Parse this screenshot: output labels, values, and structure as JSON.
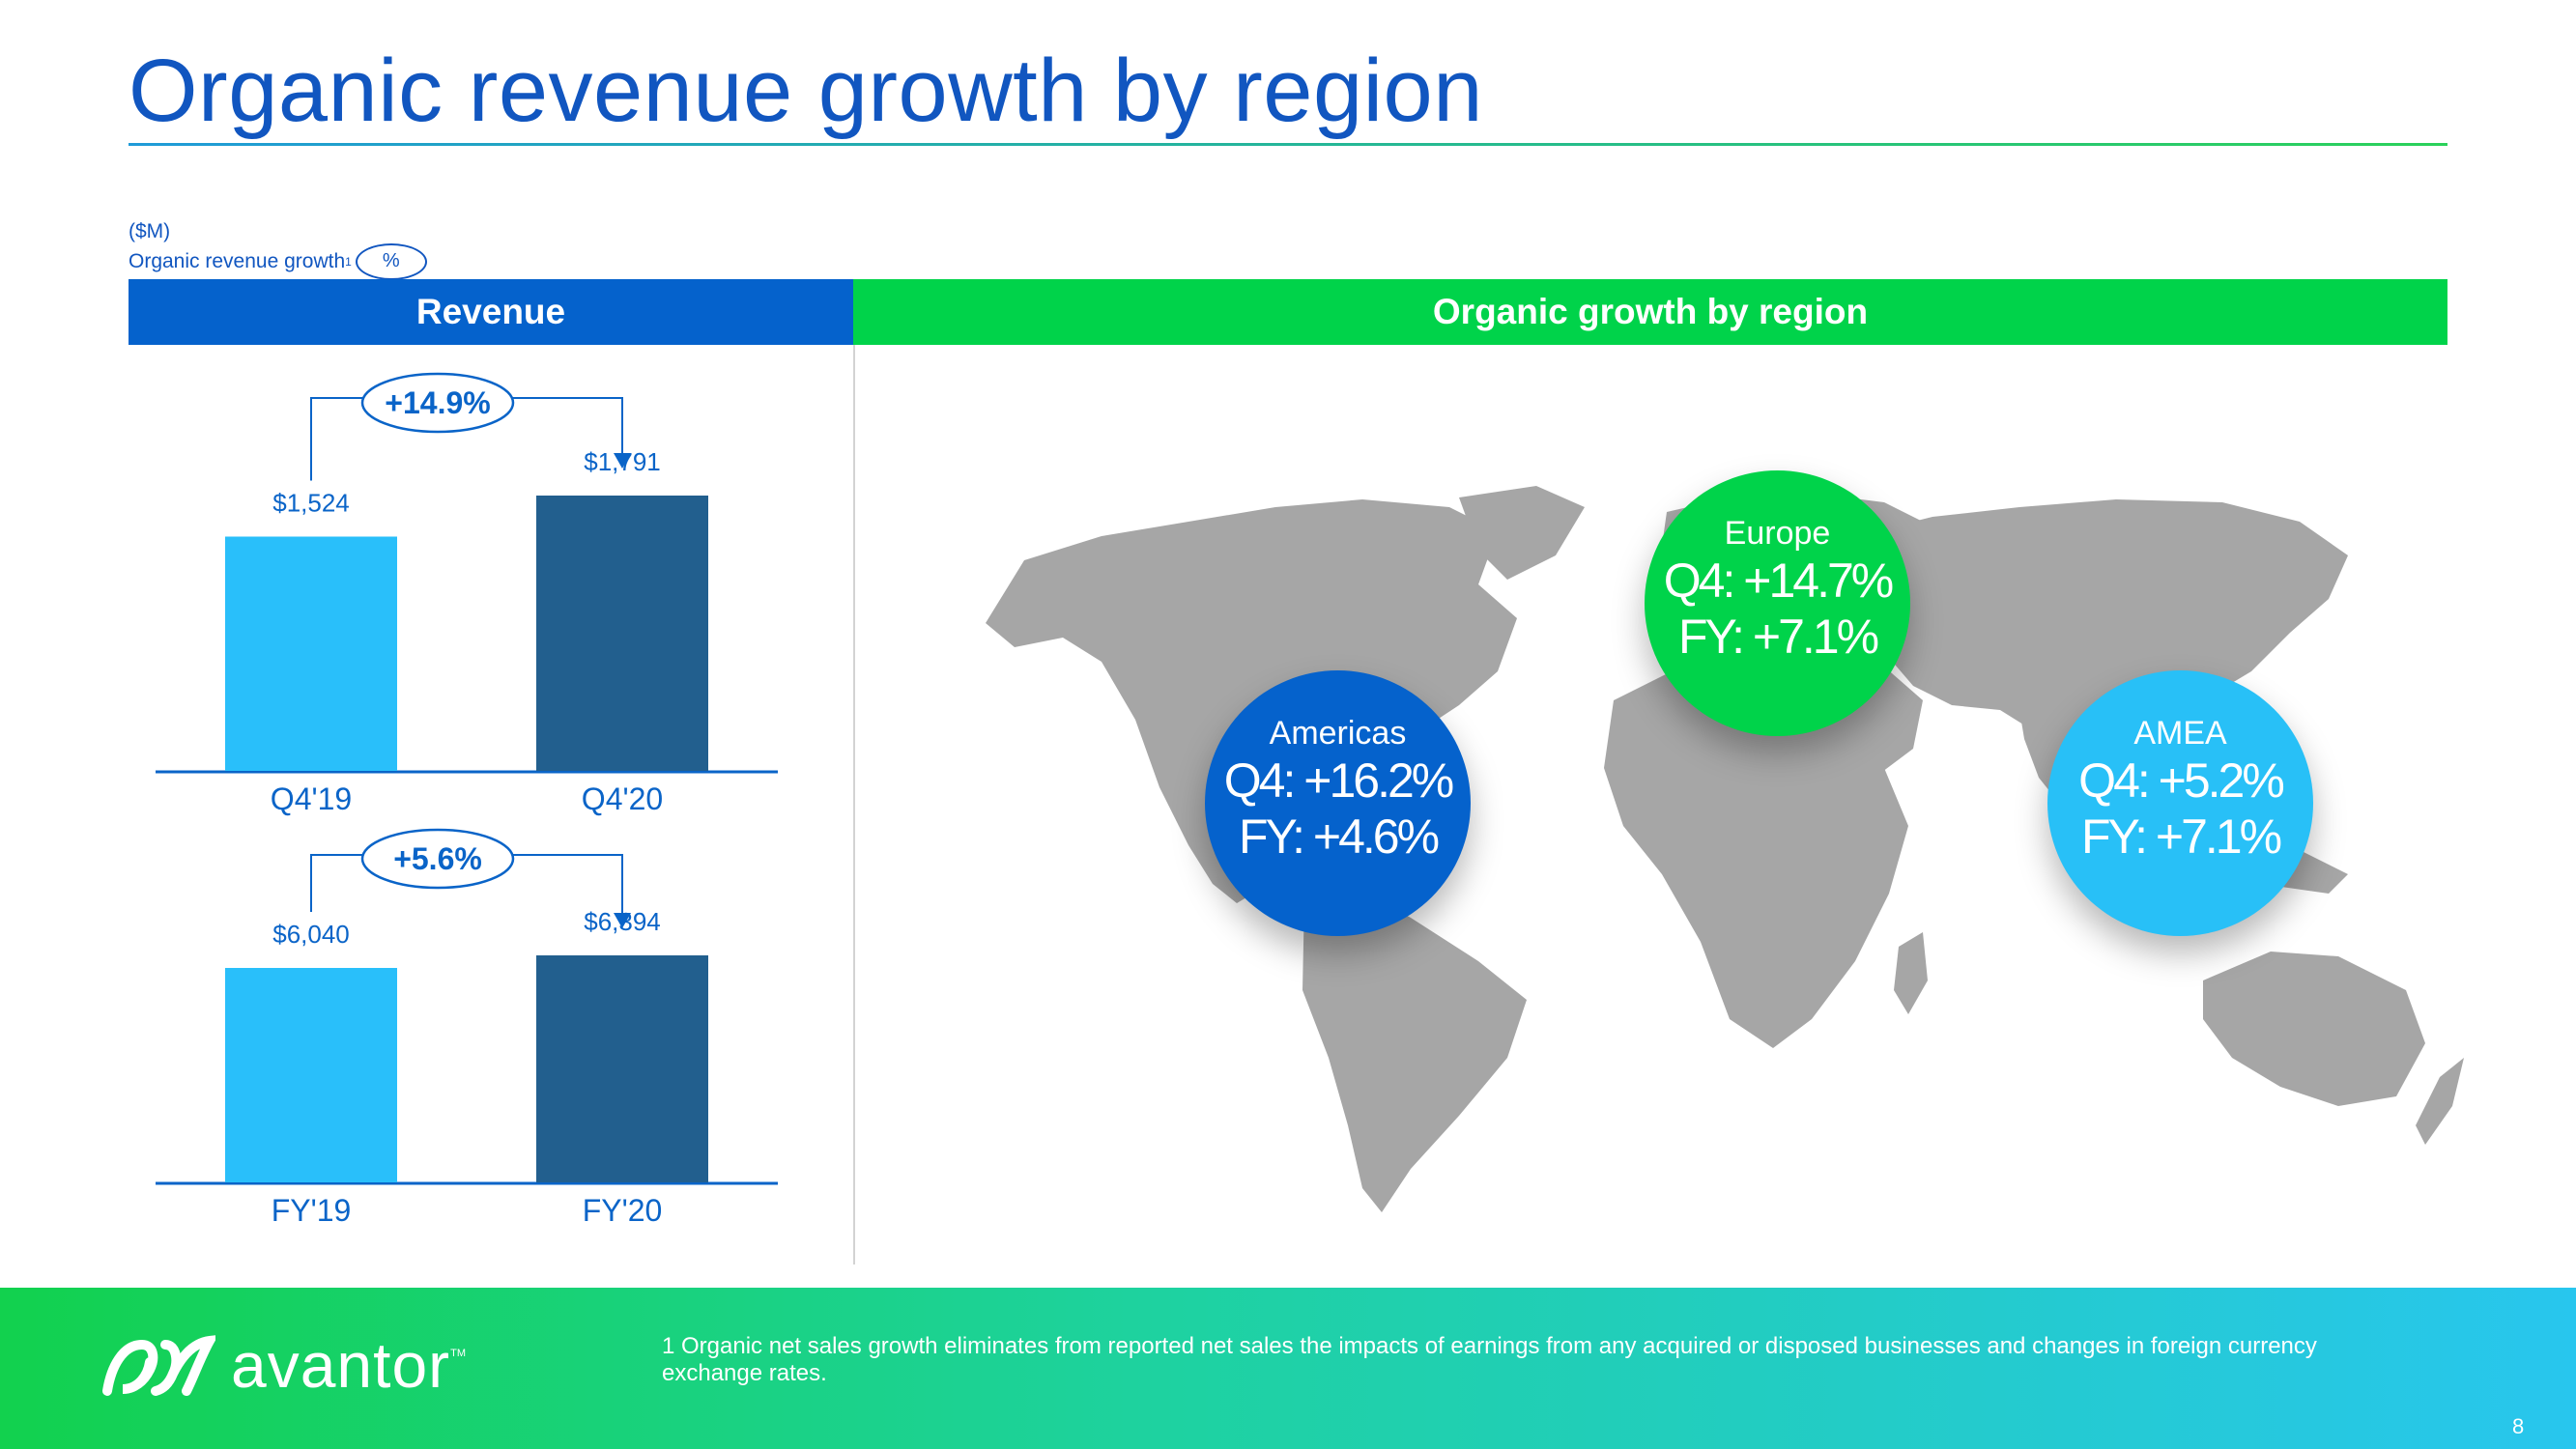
{
  "title": "Organic revenue growth by region",
  "legend": {
    "units": "($M)",
    "growth_label": "Organic revenue growth",
    "growth_sup": "1",
    "pct_symbol": "%"
  },
  "headers": {
    "revenue": "Revenue",
    "region": "Organic growth by region"
  },
  "chart_data": [
    {
      "type": "bar",
      "categories": [
        "Q4'19",
        "Q4'20"
      ],
      "values": [
        1524,
        1791
      ],
      "labels": [
        "$1,524",
        "$1,791"
      ],
      "growth": "+14.9%",
      "colors": [
        "#29bffa",
        "#225f8e"
      ]
    },
    {
      "type": "bar",
      "categories": [
        "FY'19",
        "FY'20"
      ],
      "values": [
        6040,
        6394
      ],
      "labels": [
        "$6,040",
        "$6,394"
      ],
      "growth": "+5.6%",
      "colors": [
        "#29bffa",
        "#225f8e"
      ]
    }
  ],
  "regions": {
    "americas": {
      "name": "Americas",
      "q4": "Q4: +16.2%",
      "fy": "FY: +4.6%",
      "color": "#0562cc"
    },
    "europe": {
      "name": "Europe",
      "q4": "Q4: +14.7%",
      "fy": "FY: +7.1%",
      "color": "#00d34a"
    },
    "amea": {
      "name": "AMEA",
      "q4": "Q4: +5.2%",
      "fy": "FY: +7.1%",
      "color": "#28c0f7"
    }
  },
  "footer": {
    "logo_text": "avantor",
    "logo_tm": "TM",
    "footnote": "1  Organic net sales growth eliminates from reported net sales the impacts of earnings from any acquired or disposed businesses and changes in foreign currency exchange rates.",
    "page_number": "8"
  }
}
